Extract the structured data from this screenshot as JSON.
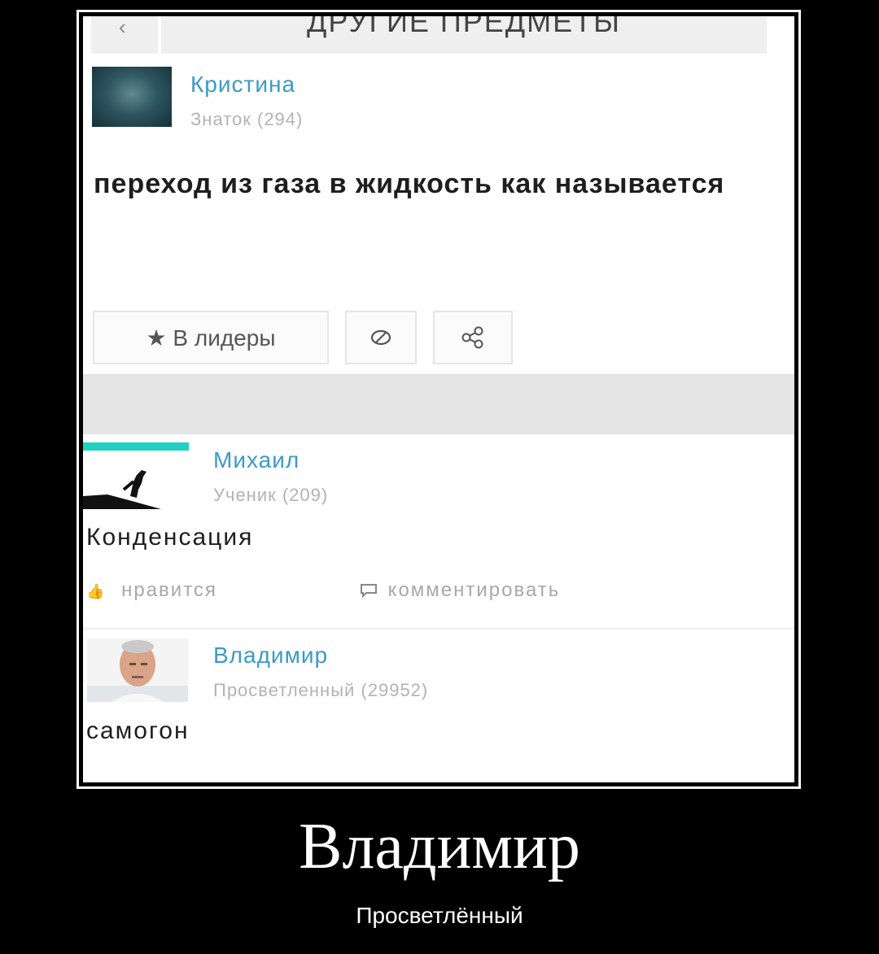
{
  "header": {
    "back_icon": "‹",
    "title": "ДРУГИЕ ПРЕДМЕТЫ"
  },
  "question": {
    "author_name": "Кристина",
    "author_rank": "Знаток (294)",
    "text": "переход из газа в жидкость как называется",
    "buttons": {
      "leaders_label": "★ В лидеры",
      "block_icon": "⊘",
      "share_icon": "share-icon"
    }
  },
  "answers": [
    {
      "author_name": "Михаил",
      "author_rank": "Ученик (209)",
      "text": "Конденсация",
      "like_label": "нравится",
      "comment_label": "комментировать"
    },
    {
      "author_name": "Владимир",
      "author_rank": "Просветленный (29952)",
      "text": "самогон"
    }
  ],
  "caption": {
    "title": "Владимир",
    "subtitle": "Просветлённый"
  },
  "colors": {
    "name_blue": "#3a9bc6",
    "rank_gray": "#b3b3b3",
    "background": "#000000"
  }
}
